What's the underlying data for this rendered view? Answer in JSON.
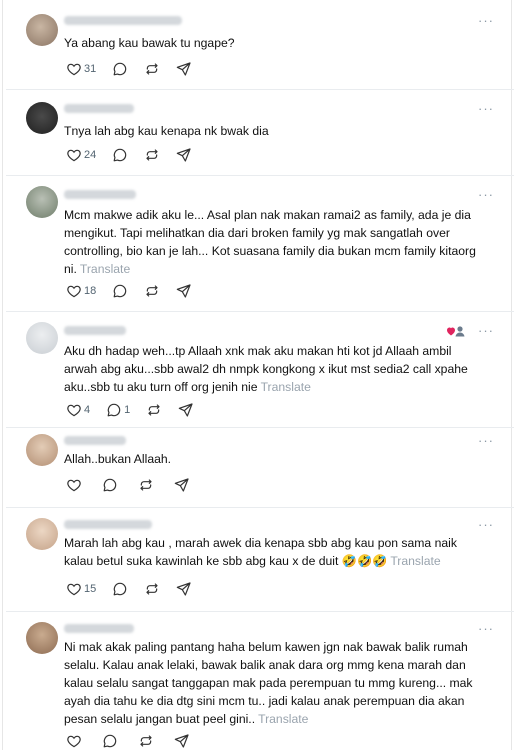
{
  "posts": [
    {
      "text": "Ya abang kau bawak tu ngape?",
      "likes": "31",
      "replies": "",
      "translate": ""
    },
    {
      "text": "Tnya lah abg kau kenapa nk bwak dia",
      "likes": "24",
      "replies": "",
      "translate": ""
    },
    {
      "text": "Mcm makwe adik aku le... Asal plan nak makan ramai2 as family, ada je dia mengikut. Tapi melihatkan dia dari broken family yg mak sangatlah over controlling, bio kan je lah... Kot suasana family dia bukan mcm family kitaorg ni.",
      "likes": "18",
      "replies": "",
      "translate": "Translate"
    },
    {
      "text": "Aku dh hadap weh...tp Allaah xnk mak aku makan hti kot jd Allaah ambil arwah abg aku...sbb awal2 dh nmpk kongkong x ikut mst sedia2 call xpahe aku..sbb tu aku turn off org jenih nie",
      "likes": "4",
      "replies": "1",
      "translate": "Translate"
    },
    {
      "text": "Allah..bukan Allaah.",
      "likes": "",
      "replies": "",
      "translate": ""
    },
    {
      "text": "Marah lah abg kau , marah awek dia kenapa sbb abg kau pon sama naik kalau betul suka kawinlah ke sbb abg kau x de duit 🤣🤣🤣",
      "likes": "15",
      "replies": "",
      "translate": "Translate"
    },
    {
      "text": "Ni mak akak paling pantang haha belum kawen jgn nak bawak balik rumah selalu. Kalau anak lelaki, bawak balik anak dara org mmg kena marah dan kalau selalu sangat tanggapan mak pada perempuan tu mmg kureng... mak ayah dia tahu ke dia dtg sini mcm tu.. jadi kalau anak perempuan dia akan pesan selalu jangan buat peel gini..",
      "likes": "",
      "replies": "",
      "translate": "Translate"
    }
  ],
  "more_glyph": "···",
  "icons": [
    "like-icon",
    "reply-icon",
    "repost-icon",
    "share-icon",
    "more-icon"
  ],
  "colors": {
    "text": "#111111",
    "muted": "#536471",
    "translate": "#9aa4ae",
    "divider": "#e9ecef"
  }
}
